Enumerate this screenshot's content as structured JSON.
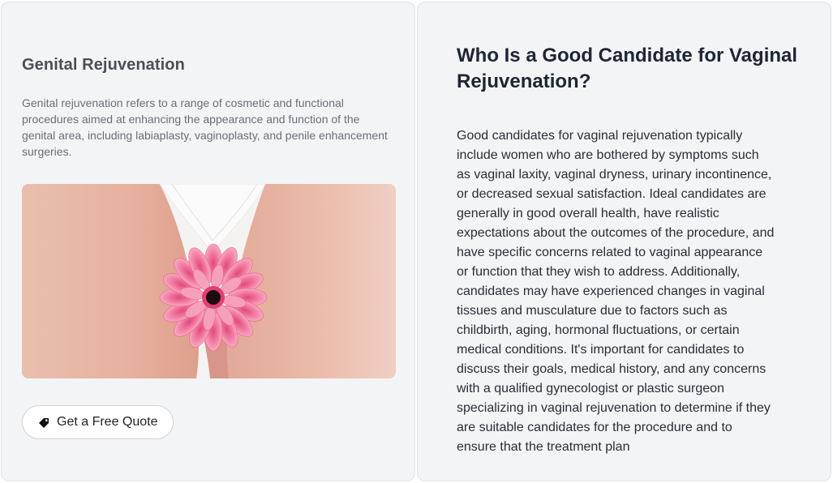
{
  "left_card": {
    "title": "Genital Rejuvenation",
    "description": "Genital rejuvenation refers to a range of cosmetic and functional procedures aimed at enhancing the appearance and function of the genital area, including labiaplasty, vaginoplasty, and penile enhancement surgeries.",
    "image_icon": "pink-gerbera-flower-photo",
    "cta": {
      "label": "Get a Free Quote",
      "icon": "tag-icon"
    }
  },
  "right_card": {
    "title": "Who Is a Good Candidate for Vaginal Rejuvenation?",
    "body": "Good candidates for vaginal rejuvenation typically include women who are bothered by symptoms such as vaginal laxity, vaginal dryness, urinary incontinence, or decreased sexual satisfaction. Ideal candidates are generally in good overall health, have realistic expectations about the outcomes of the procedure, and have specific concerns related to vaginal appearance or function that they wish to address. Additionally, candidates may have experienced changes in vaginal tissues and musculature due to factors such as childbirth, aging, hormonal fluctuations, or certain medical conditions. It's important for candidates to discuss their goals, medical history, and any concerns with a qualified gynecologist or plastic surgeon specializing in vaginal rejuvenation to determine if they are suitable candidates for the procedure and to ensure that the treatment plan"
  },
  "colors": {
    "card_bg": "#f3f4f6",
    "flower_pink": "#f27aa0",
    "heading_dark": "#1e2633"
  }
}
